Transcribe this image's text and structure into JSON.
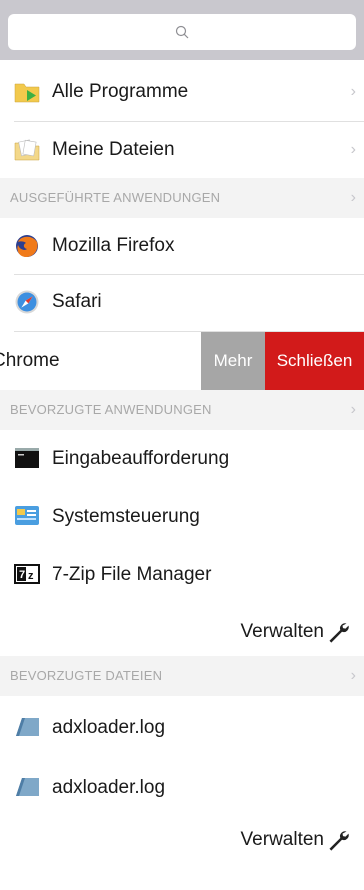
{
  "search": {
    "placeholder": "",
    "icon": "search-icon"
  },
  "top_items": [
    {
      "label": "Alle Programme",
      "icon": "folder-play-icon"
    },
    {
      "label": "Meine Dateien",
      "icon": "folder-documents-icon"
    }
  ],
  "running_section": {
    "title": "AUSGEFÜHRTE ANWENDUNGEN",
    "items": [
      {
        "label": "Mozilla Firefox",
        "icon": "firefox-icon"
      },
      {
        "label": "Safari",
        "icon": "safari-icon"
      },
      {
        "label": "Chrome",
        "icon": "chrome-icon"
      }
    ],
    "swipe_actions": {
      "more": "Mehr",
      "close": "Schließen"
    }
  },
  "favorite_apps_section": {
    "title": "BEVORZUGTE ANWENDUNGEN",
    "items": [
      {
        "label": "Eingabeaufforderung",
        "icon": "command-prompt-icon"
      },
      {
        "label": "Systemsteuerung",
        "icon": "control-panel-icon"
      },
      {
        "label": "7-Zip File Manager",
        "icon": "7zip-icon"
      }
    ],
    "manage_label": "Verwalten"
  },
  "favorite_files_section": {
    "title": "BEVORZUGTE DATEIEN",
    "items": [
      {
        "label": "adxloader.log",
        "icon": "log-file-icon"
      },
      {
        "label": "adxloader.log",
        "icon": "log-file-icon"
      }
    ],
    "manage_label": "Verwalten"
  },
  "colors": {
    "more_button": "#a6a6a6",
    "close_button": "#d21a1a",
    "section_bg": "#f3f3f3",
    "search_bar_bg": "#c9c8ce"
  }
}
